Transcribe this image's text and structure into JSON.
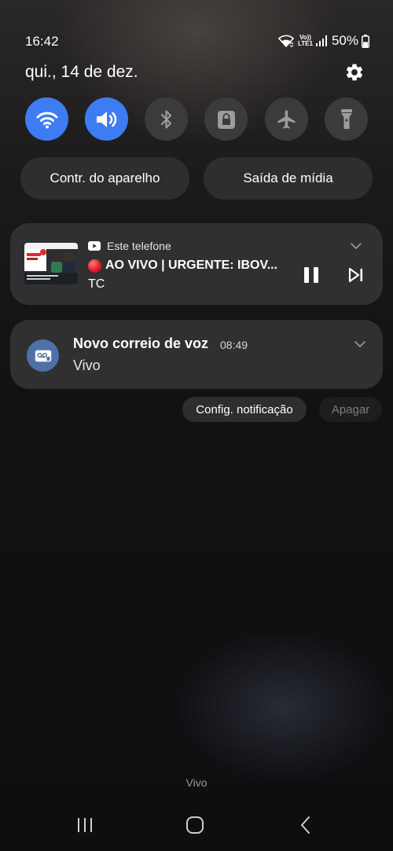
{
  "status_bar": {
    "time": "16:42",
    "network_label_top": "Vo))",
    "network_label_bottom": "LTE1",
    "battery_percent": "50%",
    "battery_level": 0.5,
    "icons": [
      "wifi-icon",
      "volte-lte-icon",
      "signal-icon",
      "battery-icon"
    ]
  },
  "header": {
    "date": "qui., 14 de dez.",
    "settings_icon": "gear-icon"
  },
  "quick_settings": [
    {
      "name": "wifi",
      "icon": "wifi-icon",
      "active": true
    },
    {
      "name": "sound",
      "icon": "volume-icon",
      "active": true
    },
    {
      "name": "bluetooth",
      "icon": "bluetooth-icon",
      "active": false
    },
    {
      "name": "rotation-lock",
      "icon": "lock-icon",
      "active": false
    },
    {
      "name": "airplane-mode",
      "icon": "airplane-icon",
      "active": false
    },
    {
      "name": "flashlight",
      "icon": "flashlight-icon",
      "active": false
    }
  ],
  "pills": {
    "device_control": "Contr. do aparelho",
    "media_output": "Saída de mídia"
  },
  "media_notification": {
    "source": "Este telefone",
    "source_icon": "youtube-icon",
    "title": "AO VIVO | URGENTE: IBOV...",
    "live_dot_color": "#e0202a",
    "subtitle": "TC",
    "controls": [
      "pause-icon",
      "skip-next-icon"
    ]
  },
  "voicemail_notification": {
    "title": "Novo correio de voz",
    "time": "08:49",
    "body": "Vivo",
    "icon": "voicemail-icon"
  },
  "notification_actions": {
    "settings": "Config. notificação",
    "clear": "Apagar"
  },
  "carrier": "Vivo",
  "navigation": [
    "recents-icon",
    "home-icon",
    "back-icon"
  ],
  "colors": {
    "accent": "#3d7cf3",
    "toggle_off": "#3b3b3b",
    "card": "#303030",
    "voicemail_icon_bg": "#4f70a8"
  }
}
